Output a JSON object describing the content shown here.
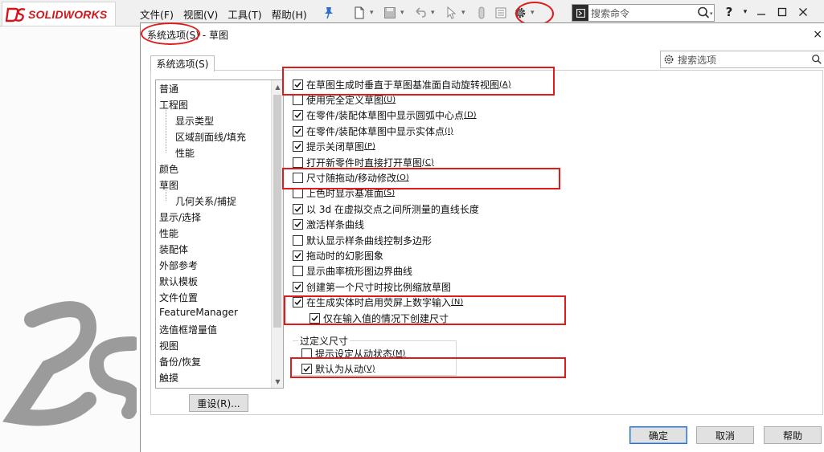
{
  "app": {
    "logo_text": "SOLIDWORKS"
  },
  "menu": [
    {
      "label": "文件(F)"
    },
    {
      "label": "视图(V)"
    },
    {
      "label": "工具(T)"
    },
    {
      "label": "帮助(H)"
    }
  ],
  "search_cmd": {
    "placeholder": "搜索命令"
  },
  "toolbar_icons": [
    "new-file-icon",
    "save-icon",
    "undo-icon",
    "select-icon",
    "rebuild-icon",
    "file-props-icon",
    "options-gear-icon",
    "help-icon",
    "minimize-icon",
    "maximize-icon",
    "close-icon"
  ],
  "dialog": {
    "title_prefix": "系统选项(S)",
    "title_suffix": " - 草图",
    "close": "×",
    "tab": "系统选项(S)",
    "search_placeholder": "搜索选项",
    "tree": [
      {
        "label": "普通",
        "level": 0
      },
      {
        "label": "工程图",
        "level": 0
      },
      {
        "label": "显示类型",
        "level": 1
      },
      {
        "label": "区域剖面线/填充",
        "level": 1
      },
      {
        "label": "性能",
        "level": 1
      },
      {
        "label": "颜色",
        "level": 0
      },
      {
        "label": "草图",
        "level": 0
      },
      {
        "label": "几何关系/捕捉",
        "level": 1
      },
      {
        "label": "显示/选择",
        "level": 0
      },
      {
        "label": "性能",
        "level": 0
      },
      {
        "label": "装配体",
        "level": 0
      },
      {
        "label": "外部参考",
        "level": 0
      },
      {
        "label": "默认模板",
        "level": 0
      },
      {
        "label": "文件位置",
        "level": 0
      },
      {
        "label": "FeatureManager",
        "level": 0
      },
      {
        "label": "选值框增量值",
        "level": 0
      },
      {
        "label": "视图",
        "level": 0
      },
      {
        "label": "备份/恢复",
        "level": 0
      },
      {
        "label": "触摸",
        "level": 0
      }
    ],
    "options": [
      {
        "text": "在草图生成时垂直于草图基准面自动旋转视图",
        "key": "(A)",
        "checked": true
      },
      {
        "text": "使用完全定义草图",
        "key": "(U)",
        "checked": false
      },
      {
        "text": "在零件/装配体草图中显示圆弧中心点",
        "key": "(D)",
        "checked": true
      },
      {
        "text": "在零件/装配体草图中显示实体点",
        "key": "(I)",
        "checked": true
      },
      {
        "text": "提示关闭草图",
        "key": "(P)",
        "checked": true
      },
      {
        "text": "打开新零件时直接打开草图",
        "key": "(C)",
        "checked": false
      },
      {
        "text": "尺寸随拖动/移动修改",
        "key": "(O)",
        "checked": false
      },
      {
        "text": "上色时显示基准面",
        "key": "(S)",
        "checked": false
      },
      {
        "text": "以 3d 在虚拟交点之间所测量的直线长度",
        "key": "",
        "checked": true
      },
      {
        "text": "激活样条曲线",
        "key": "",
        "checked": true
      },
      {
        "text": "默认显示样条曲线控制多边形",
        "key": "",
        "checked": false
      },
      {
        "text": "拖动时的幻影图象",
        "key": "",
        "checked": true
      },
      {
        "text": "显示曲率梳形图边界曲线",
        "key": "",
        "checked": false
      },
      {
        "text": "创建第一个尺寸时按比例缩放草图",
        "key": "",
        "checked": true
      },
      {
        "text": "在生成实体时启用荧屏上数字输入",
        "key": "(N)",
        "checked": true
      },
      {
        "text": "仅在输入值的情况下创建尺寸",
        "key": "",
        "checked": true,
        "indent": true
      }
    ],
    "group": {
      "label": "过定义尺寸",
      "options": [
        {
          "text": "提示设定从动状态",
          "key": "(M)",
          "checked": false
        },
        {
          "text": "默认为从动",
          "key": "(V)",
          "checked": true
        }
      ]
    },
    "buttons": {
      "reset": "重设(R)...",
      "ok": "确定",
      "cancel": "取消",
      "help": "帮助"
    }
  },
  "colors": {
    "annotation": "#e01b1b",
    "brand": "#d4141a"
  }
}
